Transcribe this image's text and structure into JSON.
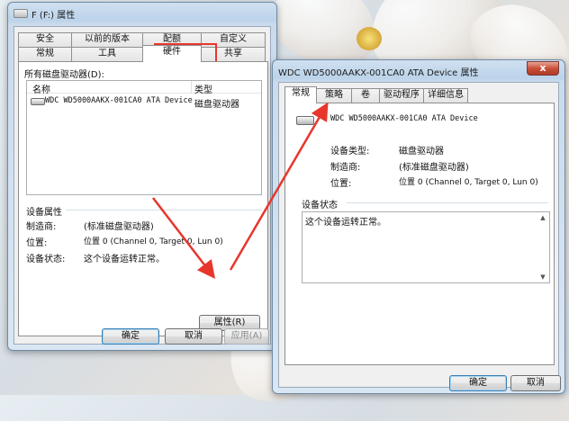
{
  "left": {
    "title": "F (F:) 属性",
    "tabs_row1": [
      "安全",
      "以前的版本",
      "配额",
      "自定义"
    ],
    "tabs_row2": [
      "常规",
      "工具",
      "硬件",
      "共享"
    ],
    "active_tab": "硬件",
    "drives_label": "所有磁盘驱动器(D):",
    "col_name": "名称",
    "col_type": "类型",
    "drive_row": {
      "name": "WDC WD5000AAKX-001CA0 ATA Device",
      "type": "磁盘驱动器"
    },
    "props_group": "设备属性",
    "manufacturer_label": "制造商:",
    "manufacturer_value": "(标准磁盘驱动器)",
    "location_label": "位置:",
    "location_value": "位置 0 (Channel 0, Target 0, Lun 0)",
    "status_label": "设备状态:",
    "status_value": "这个设备运转正常。",
    "properties_button": "属性(R)",
    "ok": "确定",
    "cancel": "取消",
    "apply": "应用(A)"
  },
  "right": {
    "title": "WDC WD5000AAKX-001CA0 ATA Device 属性",
    "close_glyph": "x",
    "tabs": [
      "常规",
      "策略",
      "卷",
      "驱动程序",
      "详细信息"
    ],
    "active_tab": "常规",
    "device_name": "WDC WD5000AAKX-001CA0 ATA Device",
    "device_type_label": "设备类型:",
    "device_type_value": "磁盘驱动器",
    "manufacturer_label": "制造商:",
    "manufacturer_value": "(标准磁盘驱动器)",
    "location_label": "位置:",
    "location_value": "位置 0 (Channel 0, Target 0, Lun 0)",
    "status_group": "设备状态",
    "status_text": "这个设备运转正常。",
    "ok": "确定",
    "cancel": "取消"
  },
  "colors": {
    "annotation": "#e8362c",
    "title_bar": "#bcd3ea"
  }
}
